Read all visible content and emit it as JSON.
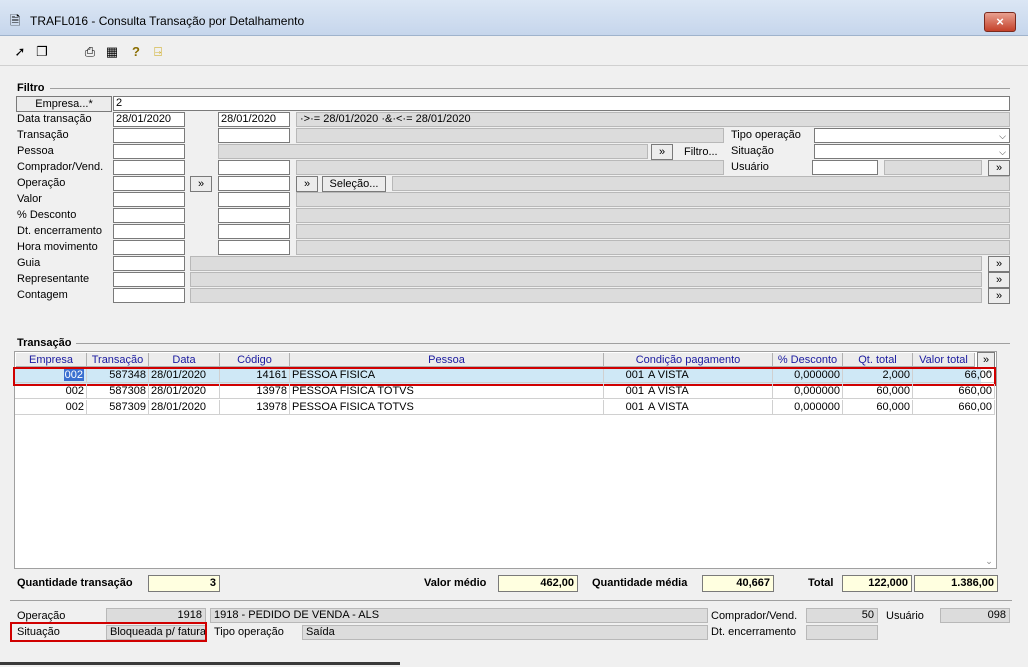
{
  "window": {
    "title": "TRAFL016 - Consulta Transação por Detalhamento",
    "close": "×"
  },
  "toolbar": {
    "icons": [
      "arrow-icon",
      "windows-icon",
      "printer-icon",
      "grid-icon",
      "help-icon",
      "exit-icon"
    ]
  },
  "filtro": {
    "title": "Filtro",
    "empresa_button": "Empresa...*",
    "empresa_value": "2",
    "labels": {
      "data_transacao": "Data transação",
      "transacao": "Transação",
      "pessoa": "Pessoa",
      "comprador": "Comprador/Vend.",
      "operacao": "Operação",
      "valor": "Valor",
      "desconto": "% Desconto",
      "dt_encerramento": "Dt. encerramento",
      "hora_movimento": "Hora movimento",
      "guia": "Guia",
      "representante": "Representante",
      "contagem": "Contagem",
      "tipo_operacao": "Tipo operação",
      "situacao": "Situação",
      "usuario": "Usuário"
    },
    "data_de": "28/01/2020",
    "data_ate": "28/01/2020",
    "data_expr": "·>·= 28/01/2020 ·&·<·= 28/01/2020",
    "more": "»",
    "filtro_button": "Filtro...",
    "selecao_button": "Seleção..."
  },
  "transacao": {
    "title": "Transação",
    "columns": [
      "Empresa",
      "Transação",
      "Data",
      "Código",
      "Pessoa",
      "Condição pagamento",
      "% Desconto",
      "Qt. total",
      "Valor total"
    ],
    "rows": [
      [
        "002",
        "587348",
        "28/01/2020",
        "14161",
        "PESSOA FISICA",
        "001",
        "A VISTA",
        "0,000000",
        "2,000",
        "66,00"
      ],
      [
        "002",
        "587308",
        "28/01/2020",
        "13978",
        "PESSOA FISICA TOTVS",
        "001",
        "A VISTA",
        "0,000000",
        "60,000",
        "660,00"
      ],
      [
        "002",
        "587309",
        "28/01/2020",
        "13978",
        "PESSOA FISICA TOTVS",
        "001",
        "A VISTA",
        "0,000000",
        "60,000",
        "660,00"
      ]
    ]
  },
  "totals": {
    "qtd_transacao_label": "Quantidade transação",
    "qtd_transacao": "3",
    "valor_medio_label": "Valor médio",
    "valor_medio": "462,00",
    "qtd_media_label": "Quantidade média",
    "qtd_media": "40,667",
    "total_label": "Total",
    "total_qt": "122,000",
    "total_valor": "1.386,00"
  },
  "detail": {
    "operacao_label": "Operação",
    "operacao_code": "1918",
    "operacao_desc": "1918 -  PEDIDO DE VENDA - ALS",
    "comprador_label": "Comprador/Vend.",
    "comprador_value": "50",
    "usuario_label": "Usuário",
    "usuario_value": "098",
    "situacao_label": "Situação",
    "situacao_value": "Bloqueada p/ fatura",
    "tipo_operacao_label": "Tipo operação",
    "tipo_operacao_value": "Saída",
    "dt_encerramento_label": "Dt. encerramento"
  },
  "colors": {
    "highlight_row": "#cfe8f6",
    "red_outline": "#d00000",
    "header_text": "#1a1aa0",
    "totals_bg": "#ffffe0"
  }
}
